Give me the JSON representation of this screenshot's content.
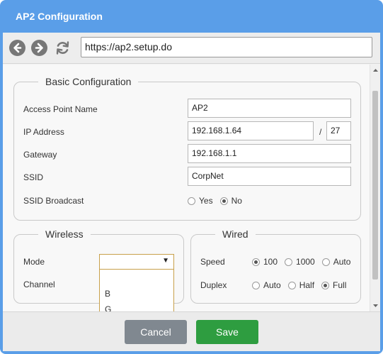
{
  "window": {
    "title": "AP2 Configuration"
  },
  "toolbar": {
    "back_icon": "arrow-left-icon",
    "forward_icon": "arrow-right-icon",
    "refresh_icon": "refresh-icon",
    "url": "https://ap2.setup.do"
  },
  "basic": {
    "legend": "Basic Configuration",
    "ap_name_label": "Access Point Name",
    "ap_name_value": "AP2",
    "ip_label": "IP Address",
    "ip_value": "192.168.1.64",
    "ip_separator": "/",
    "prefix_value": "27",
    "gateway_label": "Gateway",
    "gateway_value": "192.168.1.1",
    "ssid_label": "SSID",
    "ssid_value": "CorpNet",
    "broadcast_label": "SSID Broadcast",
    "broadcast_options": [
      "Yes",
      "No"
    ],
    "broadcast_selected": "No"
  },
  "wireless": {
    "legend": "Wireless",
    "mode_label": "Mode",
    "mode_value": "",
    "mode_options": [
      "",
      "B",
      "G"
    ],
    "channel_label": "Channel"
  },
  "wired": {
    "legend": "Wired",
    "speed_label": "Speed",
    "speed_options": [
      "100",
      "1000",
      "Auto"
    ],
    "speed_selected": "100",
    "duplex_label": "Duplex",
    "duplex_options": [
      "Auto",
      "Half",
      "Full"
    ],
    "duplex_selected": "Full"
  },
  "footer": {
    "cancel_label": "Cancel",
    "save_label": "Save"
  },
  "colors": {
    "titlebar": "#5a9ee8",
    "save": "#2e9d40",
    "cancel": "#808890",
    "select_border": "#c8a04a"
  }
}
